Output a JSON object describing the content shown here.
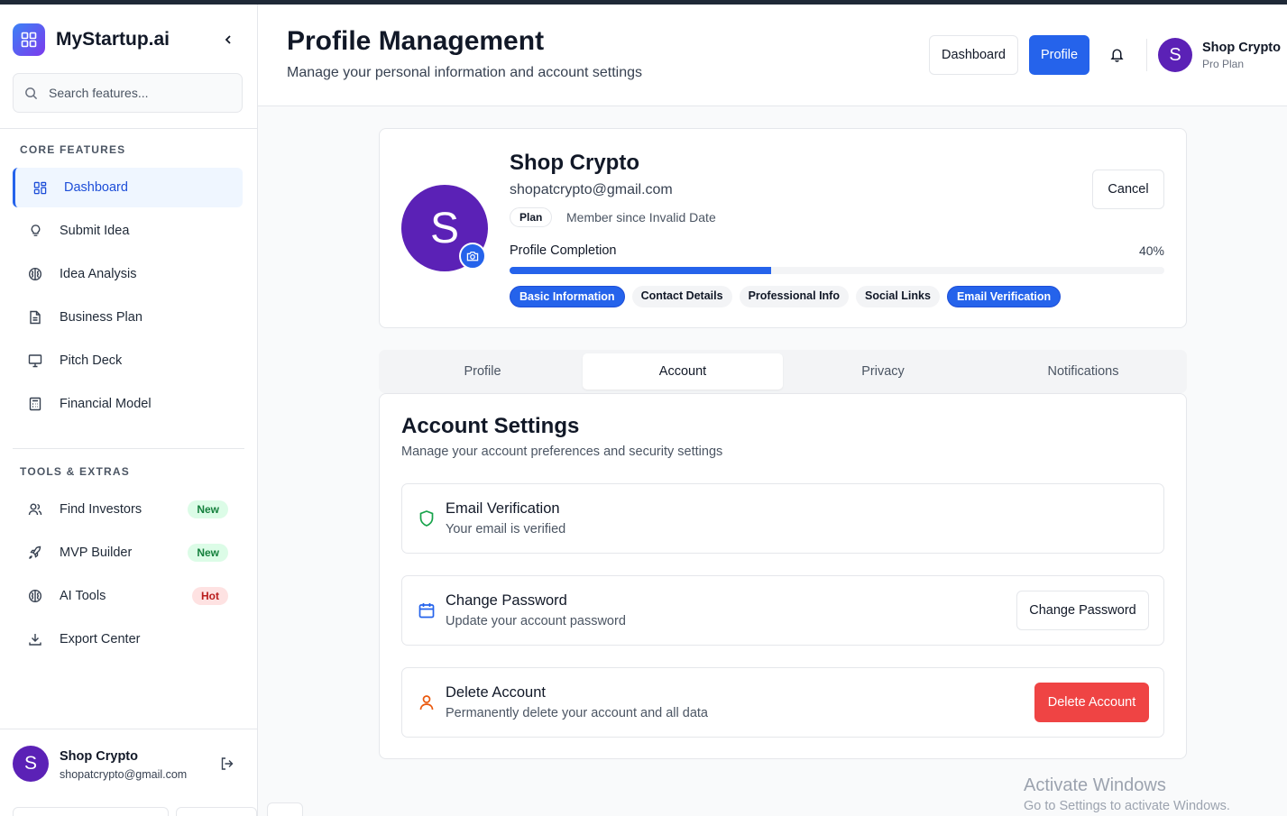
{
  "brand": {
    "name": "MyStartup.ai"
  },
  "search": {
    "placeholder": "Search features..."
  },
  "sidebar": {
    "core_title": "CORE FEATURES",
    "core_items": [
      {
        "label": "Dashboard",
        "icon": "grid-icon"
      },
      {
        "label": "Submit Idea",
        "icon": "lightbulb-icon"
      },
      {
        "label": "Idea Analysis",
        "icon": "brain-icon"
      },
      {
        "label": "Business Plan",
        "icon": "document-icon"
      },
      {
        "label": "Pitch Deck",
        "icon": "presentation-icon"
      },
      {
        "label": "Financial Model",
        "icon": "calculator-icon"
      }
    ],
    "tools_title": "TOOLS & EXTRAS",
    "tools_items": [
      {
        "label": "Find Investors",
        "icon": "users-icon",
        "badge": "New"
      },
      {
        "label": "MVP Builder",
        "icon": "rocket-icon",
        "badge": "New"
      },
      {
        "label": "AI Tools",
        "icon": "brain-icon",
        "badge": "Hot"
      },
      {
        "label": "Export Center",
        "icon": "download-icon"
      }
    ],
    "user": {
      "initial": "S",
      "name": "Shop Crypto",
      "email": "shopatcrypto@gmail.com"
    }
  },
  "header": {
    "title": "Profile Management",
    "subtitle": "Manage your personal information and account settings",
    "dashboard_label": "Dashboard",
    "profile_label": "Profile",
    "user": {
      "initial": "S",
      "name": "Shop Crypto",
      "plan": "Pro Plan"
    }
  },
  "profile_card": {
    "initial": "S",
    "name": "Shop Crypto",
    "email": "shopatcrypto@gmail.com",
    "plan_label": "Plan",
    "member_since": "Member since Invalid Date",
    "cancel_label": "Cancel",
    "completion_label": "Profile Completion",
    "completion_text": "40%",
    "completion_value": 0.4,
    "chips": [
      {
        "label": "Basic Information",
        "done": true
      },
      {
        "label": "Contact Details",
        "done": false
      },
      {
        "label": "Professional Info",
        "done": false
      },
      {
        "label": "Social Links",
        "done": false
      },
      {
        "label": "Email Verification",
        "done": true
      }
    ]
  },
  "tabs": [
    {
      "label": "Profile",
      "active": false
    },
    {
      "label": "Account",
      "active": true
    },
    {
      "label": "Privacy",
      "active": false
    },
    {
      "label": "Notifications",
      "active": false
    }
  ],
  "account": {
    "title": "Account Settings",
    "subtitle": "Manage your account preferences and security settings",
    "rows": [
      {
        "title": "Email Verification",
        "subtitle": "Your email is verified",
        "icon": "shield-icon"
      },
      {
        "title": "Change Password",
        "subtitle": "Update your account password",
        "icon": "calendar-icon",
        "button": "Change Password"
      },
      {
        "title": "Delete Account",
        "subtitle": "Permanently delete your account and all data",
        "icon": "user-icon",
        "button": "Delete Account"
      }
    ]
  },
  "watermark": {
    "line1": "Activate Windows",
    "line2": "Go to Settings to activate Windows."
  },
  "colors": {
    "accent": "#2563eb",
    "avatar": "#5b21b6",
    "danger": "#ef4444",
    "success": "#16a34a"
  }
}
